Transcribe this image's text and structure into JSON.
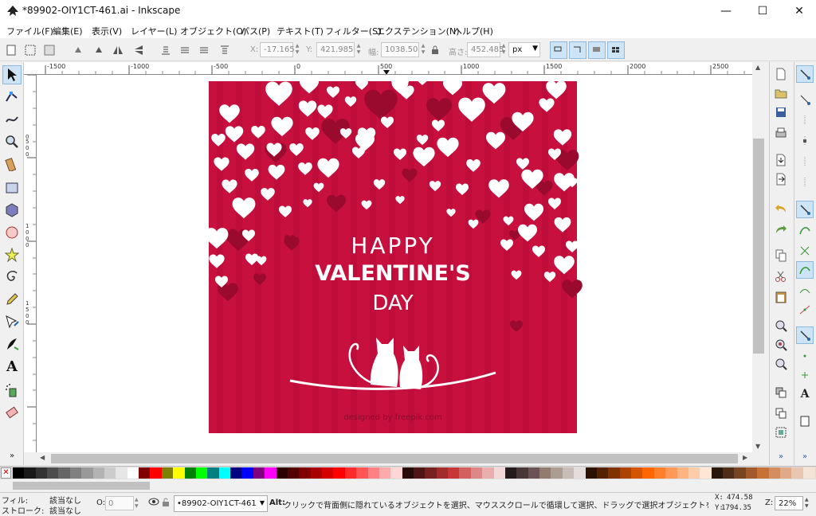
{
  "window": {
    "title": "*89902-OIY1CT-461.ai - Inkscape",
    "minimize": "—",
    "maximize": "☐",
    "close": "✕"
  },
  "menu": [
    "ファイル(F)",
    "編集(E)",
    "表示(V)",
    "レイヤー(L)",
    "オブジェクト(O)",
    "パス(P)",
    "テキスト(T)",
    "フィルター(S)",
    "エクステンション(N)",
    "ヘルプ(H)"
  ],
  "controls": {
    "x_label": "X:",
    "x_value": "-17.165",
    "y_label": "Y:",
    "y_value": "421.985",
    "w_label": "幅:",
    "w_value": "1038.50",
    "h_label": "高さ:",
    "h_value": "452.485",
    "unit": "px"
  },
  "ruler": {
    "h_labels": [
      "-1500",
      "-1000",
      "-500",
      "0",
      "500",
      "1000",
      "1500",
      "2000",
      "2500"
    ],
    "v_labels": [
      "0",
      "500",
      "1000",
      "1500"
    ]
  },
  "artwork": {
    "line1": "HAPPY",
    "line2": "VALENTINE'S",
    "line3": "DAY",
    "credit": "designed by freepik.com",
    "bg_color": "#c8103e",
    "heart_white": "#ffffff",
    "heart_dark": "#9a0a2e"
  },
  "palette": {
    "none_label": "✕",
    "colors": [
      "#000000",
      "#1a1a1a",
      "#333333",
      "#4d4d4d",
      "#666666",
      "#808080",
      "#999999",
      "#b3b3b3",
      "#cccccc",
      "#e6e6e6",
      "#ffffff",
      "#800000",
      "#ff0000",
      "#808000",
      "#ffff00",
      "#008000",
      "#00ff00",
      "#008080",
      "#00ffff",
      "#000080",
      "#0000ff",
      "#800080",
      "#ff00ff",
      "#2b0000",
      "#550000",
      "#800000",
      "#aa0000",
      "#d40000",
      "#ff0000",
      "#ff2a2a",
      "#ff5555",
      "#ff8080",
      "#ffaaaa",
      "#ffd5d5",
      "#280b0b",
      "#501616",
      "#782121",
      "#a02c2c",
      "#c83737",
      "#d35f5f",
      "#de8787",
      "#e9afaf",
      "#f4d7d7",
      "#241c1c",
      "#483737",
      "#6c5353",
      "#917c6f",
      "#ac9d93",
      "#c8beb7",
      "#e3dedb",
      "#2b1100",
      "#552200",
      "#803300",
      "#aa4400",
      "#d45500",
      "#ff6600",
      "#ff7f2a",
      "#ff9955",
      "#ffb380",
      "#ffccaa",
      "#ffe6d5",
      "#28170b",
      "#502d16",
      "#784421",
      "#a05a2c",
      "#c87137",
      "#d38d5f",
      "#deaa87",
      "#e9c6af",
      "#f4e3d7"
    ]
  },
  "status": {
    "fill_label": "フィル:",
    "fill_value": "該当なし",
    "stroke_label": "ストローク:",
    "stroke_value": "該当なし",
    "opacity_label": "O:",
    "opacity_value": "0",
    "layer": "•89902-OIY1CT-461",
    "message_bold": "Alt:",
    "message": "クリックで背面側に隠れているオブジェクトを選択、マウススクロールで循環して選択、ドラッグで選択オブジェクトを移動また...",
    "x_label": "X:",
    "x_value": "474.58",
    "y_label": "Y:",
    "y_value": "1794.35",
    "zoom_label": "Z:",
    "zoom_value": "22%"
  }
}
